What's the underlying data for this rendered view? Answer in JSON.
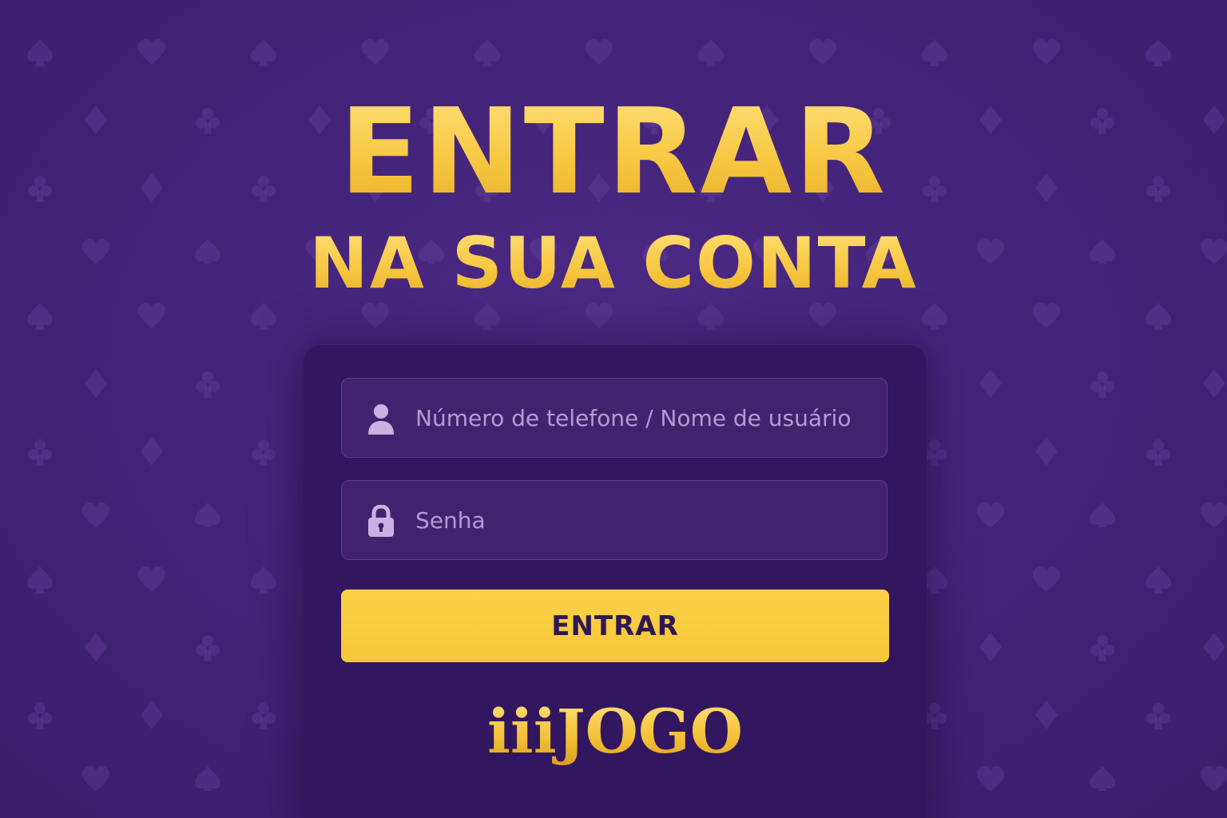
{
  "header": {
    "title": "ENTRAR",
    "subtitle": "NA SUA CONTA"
  },
  "login_form": {
    "username": {
      "icon": "user-icon",
      "placeholder": "Número de telefone / Nome de usuário",
      "value": ""
    },
    "password": {
      "icon": "lock-icon",
      "placeholder": "Senha",
      "value": ""
    },
    "submit_label": "ENTRAR"
  },
  "brand": {
    "logo_text": "iiiJOGO"
  },
  "background": {
    "pattern": "card-suits",
    "suits": [
      "spade",
      "heart",
      "diamond",
      "club"
    ]
  },
  "colors": {
    "background": "#44247a",
    "card": "#331660",
    "field": "#42226f",
    "accent_gold": "#f7c948",
    "button": "#f8cc40",
    "button_text": "#2f1852",
    "placeholder": "#b49ad6"
  }
}
